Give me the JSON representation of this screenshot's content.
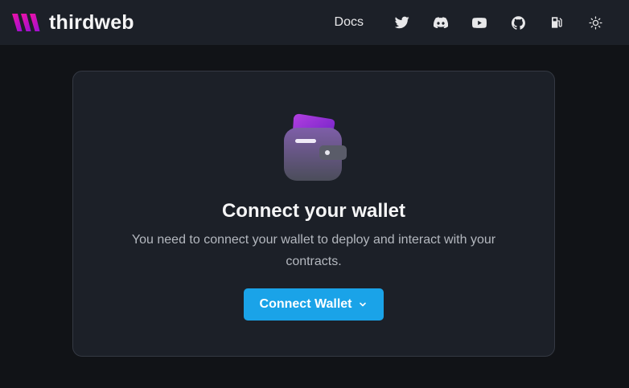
{
  "header": {
    "brand_name": "thirdweb",
    "brand_colors": {
      "from": "#f213a4",
      "to": "#5204bf"
    },
    "docs_label": "Docs",
    "icons": [
      "twitter-icon",
      "discord-icon",
      "youtube-icon",
      "github-icon",
      "gas-pump-icon",
      "sun-icon"
    ]
  },
  "card": {
    "title": "Connect your wallet",
    "description": "You need to connect your wallet to deploy and interact with your contracts.",
    "button_label": "Connect Wallet",
    "button_color": "#1aa3e8"
  },
  "colors": {
    "page_bg": "#111317",
    "surface": "#1c2028",
    "border": "#343943"
  }
}
